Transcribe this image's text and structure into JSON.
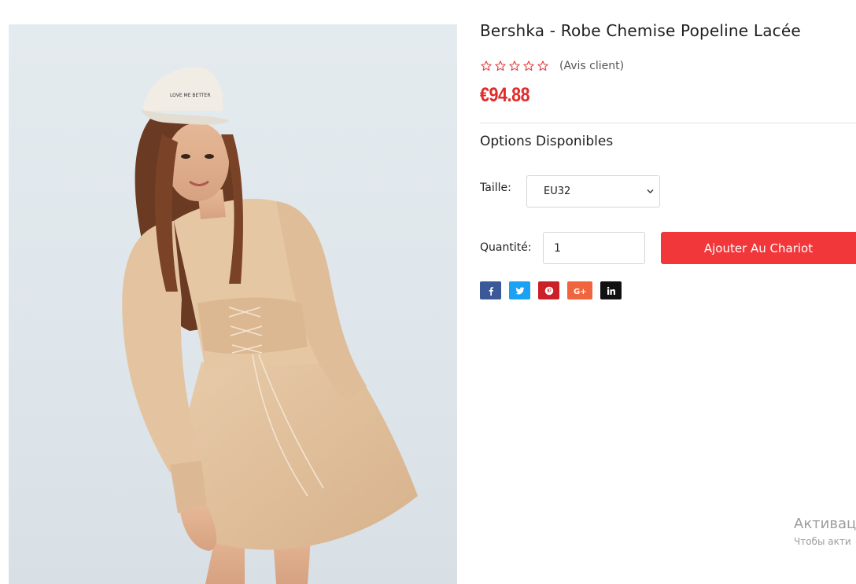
{
  "product": {
    "title": "Bershka - Robe Chemise Popeline Lacée",
    "rating_stars": 0,
    "rating_max": 5,
    "reviews_label": "(Avis client)",
    "price": "€94.88",
    "image_cap_text": "LOVE ME BETTER"
  },
  "options": {
    "heading": "Options Disponibles",
    "size_label": "Taille:",
    "size_selected": "EU32"
  },
  "purchase": {
    "quantity_label": "Quantité:",
    "quantity_value": "1",
    "add_to_cart_label": "Ajouter Au Chariot"
  },
  "share": [
    {
      "icon": "facebook-icon",
      "color": "#3b5998"
    },
    {
      "icon": "twitter-icon",
      "color": "#1da1f2"
    },
    {
      "icon": "pinterest-icon",
      "color": "#cb2027"
    },
    {
      "icon": "google-plus-icon",
      "color": "#f0653e"
    },
    {
      "icon": "linkedin-icon",
      "color": "#111111"
    }
  ],
  "colors": {
    "accent": "#f2373a",
    "price": "#e32a2a",
    "star_outline": "#e33b3b"
  },
  "watermark": {
    "title": "Активац",
    "subtitle": "Чтобы акти"
  }
}
